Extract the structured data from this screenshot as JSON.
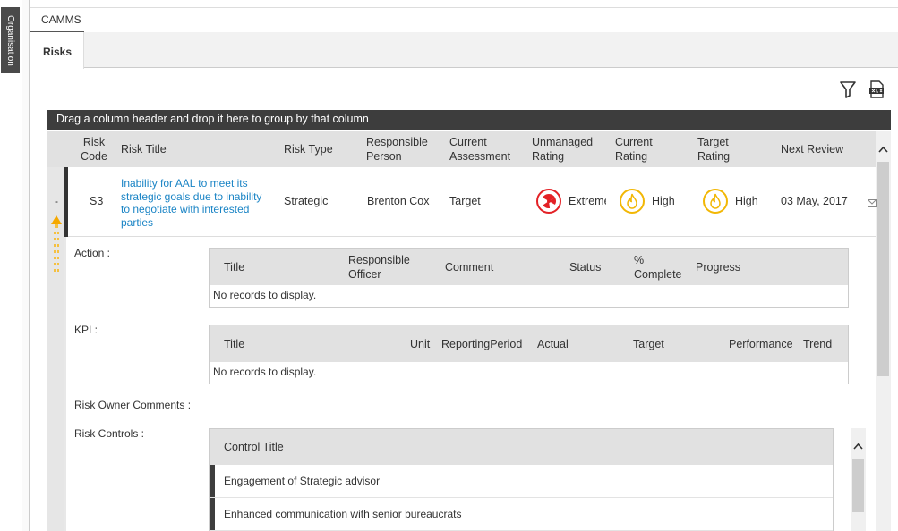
{
  "sidebar": {
    "org_label": "Organisation"
  },
  "tabs": {
    "top": "CAMMS",
    "sub": "Risks"
  },
  "toolbar": {
    "filter_icon": "filter-icon",
    "export_icon": "xlsx-export-icon"
  },
  "grid": {
    "group_hint": "Drag a column header and drop it here to group by that column",
    "headers": {
      "code": "Risk Code",
      "title": "Risk Title",
      "type": "Risk Type",
      "person": "Responsible Person",
      "assessment": "Current Assessment",
      "unmanaged": "Unmanaged Rating",
      "current": "Current Rating",
      "target": "Target Rating",
      "review": "Next Review"
    },
    "row": {
      "collapse": "-",
      "code": "S3",
      "title": "Inability for AAL to meet its strategic goals due to inability to negotiate with interested parties",
      "type": "Strategic",
      "person": "Brenton Cox",
      "assessment": "Target",
      "unmanaged": {
        "label": "Extreme",
        "color": "#e32126",
        "icon": "radiation-icon"
      },
      "current": {
        "label": "High",
        "color": "#f2b705",
        "icon": "flame-icon"
      },
      "target": {
        "label": "High",
        "color": "#f2b705",
        "icon": "flame-icon"
      },
      "review": "03 May, 2017"
    }
  },
  "detail": {
    "action_label": "Action :",
    "action_headers": {
      "title": "Title",
      "officer": "Responsible Officer",
      "comment": "Comment",
      "status": "Status",
      "complete": "% Complete",
      "progress": "Progress"
    },
    "action_empty": "No records to display.",
    "kpi_label": "KPI :",
    "kpi_headers": {
      "title": "Title",
      "unit": "Unit",
      "period": "ReportingPeriod",
      "actual": "Actual",
      "target": "Target",
      "performance": "Performance",
      "trend": "Trend"
    },
    "kpi_empty": "No records to display.",
    "owner_comments_label": "Risk Owner Comments :",
    "controls_label": "Risk Controls :",
    "controls_header": "Control Title",
    "controls": [
      "Engagement of Strategic advisor",
      "Enhanced communication with senior bureaucrats"
    ]
  }
}
